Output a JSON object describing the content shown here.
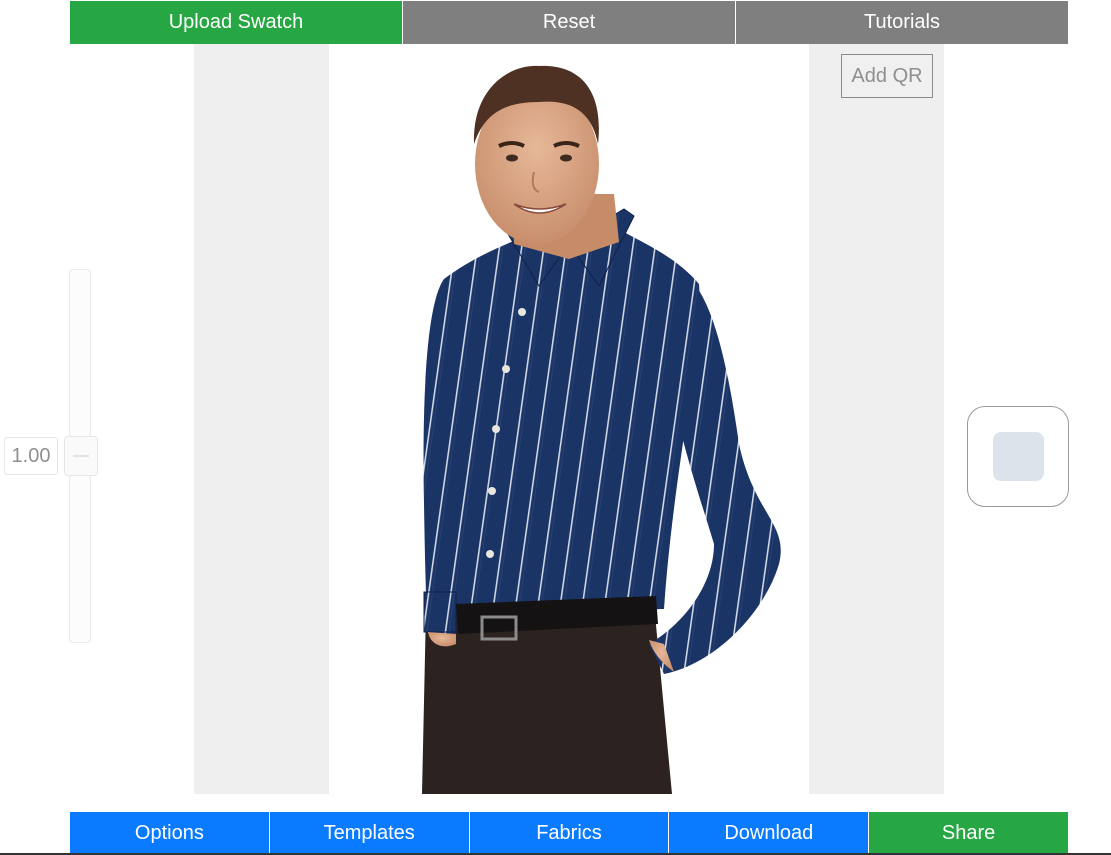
{
  "toolbar": {
    "upload_label": "Upload Swatch",
    "reset_label": "Reset",
    "tutorials_label": "Tutorials"
  },
  "canvas": {
    "add_qr_label": "Add QR",
    "model_image": "man-in-striped-navy-shirt"
  },
  "zoom": {
    "value": "1.00"
  },
  "swatch": {
    "color": "#dde3ea"
  },
  "bottom_nav": {
    "options_label": "Options",
    "templates_label": "Templates",
    "fabrics_label": "Fabrics",
    "download_label": "Download",
    "share_label": "Share"
  },
  "colors": {
    "green": "#27a744",
    "gray": "#7f7f7f",
    "blue": "#0a7bff",
    "shirt": "#1b3466"
  }
}
